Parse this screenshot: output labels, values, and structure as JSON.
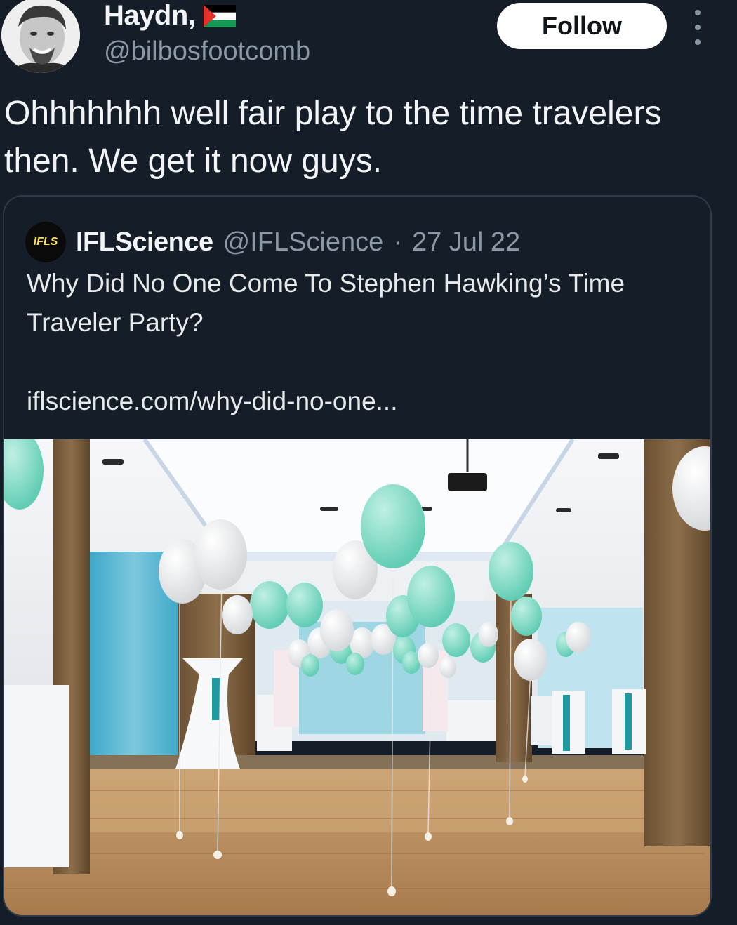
{
  "tweet": {
    "display_name": "Haydn,",
    "handle": "@bilbosfootcomb",
    "follow_label": "Follow",
    "text": "Ohhhhhhh well fair play to the time travelers then. We get it now guys.",
    "icons": {
      "more": "more-vertical-icon",
      "flag": "palestine-flag-icon"
    },
    "colors": {
      "flag_black": "#000000",
      "flag_white": "#ffffff",
      "flag_green": "#149954",
      "flag_red": "#e4312b"
    }
  },
  "quote": {
    "avatar_text": "IFLS",
    "name": "IFLScience",
    "handle": "@IFLScience",
    "separator": "·",
    "date": "27 Jul 22",
    "text": "Why Did No One Come To Stephen Hawking’s Time Traveler Party?",
    "link": "iflscience.com/why-did-no-one..."
  },
  "colors": {
    "background": "#151d28",
    "text": "#e7e9ea",
    "muted": "#8b98a5",
    "balloon_teal": "#7fd9c3",
    "balloon_white": "#f4f5f6"
  }
}
